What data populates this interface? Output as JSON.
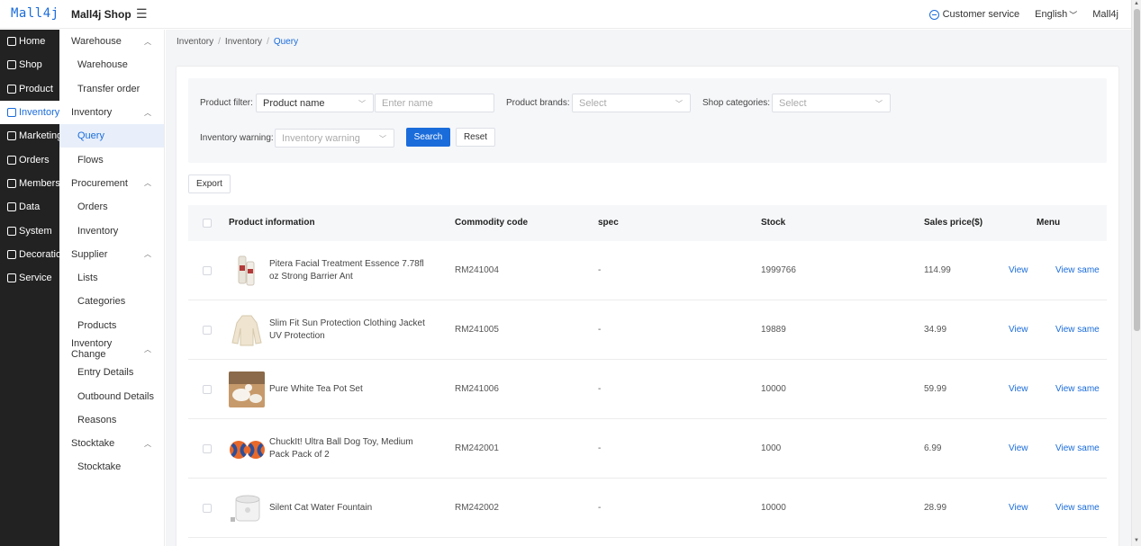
{
  "header": {
    "logo": "Mall4j",
    "shop_name": "Mall4j Shop",
    "customer_service": "Customer service",
    "language": "English",
    "user": "Mall4j"
  },
  "sidebar": {
    "items": [
      {
        "label": "Home",
        "icon": "home-icon"
      },
      {
        "label": "Shop",
        "icon": "shop-icon"
      },
      {
        "label": "Product",
        "icon": "product-icon"
      },
      {
        "label": "Inventory",
        "icon": "inventory-icon"
      },
      {
        "label": "Marketing",
        "icon": "marketing-icon"
      },
      {
        "label": "Orders",
        "icon": "orders-icon"
      },
      {
        "label": "Members",
        "icon": "members-icon"
      },
      {
        "label": "Data",
        "icon": "data-icon"
      },
      {
        "label": "System",
        "icon": "system-icon"
      },
      {
        "label": "Decoration",
        "icon": "decoration-icon"
      },
      {
        "label": "Service",
        "icon": "service-icon"
      }
    ]
  },
  "submenu": {
    "warehouse_group": "Warehouse",
    "warehouse": "Warehouse",
    "transfer_order": "Transfer order",
    "inventory_group": "Inventory",
    "query": "Query",
    "flows": "Flows",
    "procurement_group": "Procurement",
    "orders": "Orders",
    "inventory": "Inventory",
    "supplier_group": "Supplier",
    "lists": "Lists",
    "categories": "Categories",
    "products": "Products",
    "inventory_change_group": "Inventory Change",
    "entry_details": "Entry Details",
    "outbound_details": "Outbound Details",
    "reasons": "Reasons",
    "stocktake_group": "Stocktake",
    "stocktake": "Stocktake"
  },
  "breadcrumb": [
    "Inventory",
    "Inventory",
    "Query"
  ],
  "filters": {
    "product_filter_label": "Product filter:",
    "product_filter_value": "Product name",
    "name_placeholder": "Enter name",
    "brands_label": "Product brands:",
    "brands_placeholder": "Select",
    "shop_categories_label": "Shop categories:",
    "shop_categories_placeholder": "Select",
    "warning_label": "Inventory warning:",
    "warning_placeholder": "Inventory warning",
    "search": "Search",
    "reset": "Reset"
  },
  "export": "Export",
  "table": {
    "columns": {
      "product": "Product information",
      "code": "Commodity code",
      "spec": "spec",
      "stock": "Stock",
      "price": "Sales price($)",
      "menu": "Menu"
    },
    "rows": [
      {
        "name": "Pitera Facial Treatment Essence 7.78fl oz Strong Barrier Ant",
        "code": "RM241004",
        "spec": "-",
        "stock": "1999766",
        "price": "114.99",
        "view": "View",
        "view_same": "View same"
      },
      {
        "name": "Slim Fit Sun Protection Clothing Jacket UV Protection",
        "code": "RM241005",
        "spec": "-",
        "stock": "19889",
        "price": "34.99",
        "view": "View",
        "view_same": "View same"
      },
      {
        "name": "Pure White Tea Pot Set",
        "code": "RM241006",
        "spec": "-",
        "stock": "10000",
        "price": "59.99",
        "view": "View",
        "view_same": "View same"
      },
      {
        "name": "ChuckIt! Ultra Ball Dog Toy, Medium Pack Pack of 2",
        "code": "RM242001",
        "spec": "-",
        "stock": "1000",
        "price": "6.99",
        "view": "View",
        "view_same": "View same"
      },
      {
        "name": "Silent Cat Water Fountain",
        "code": "RM242002",
        "spec": "-",
        "stock": "10000",
        "price": "28.99",
        "view": "View",
        "view_same": "View same"
      }
    ]
  },
  "colors": {
    "accent": "#1a6cdb",
    "sidebar_bg": "#222222"
  }
}
